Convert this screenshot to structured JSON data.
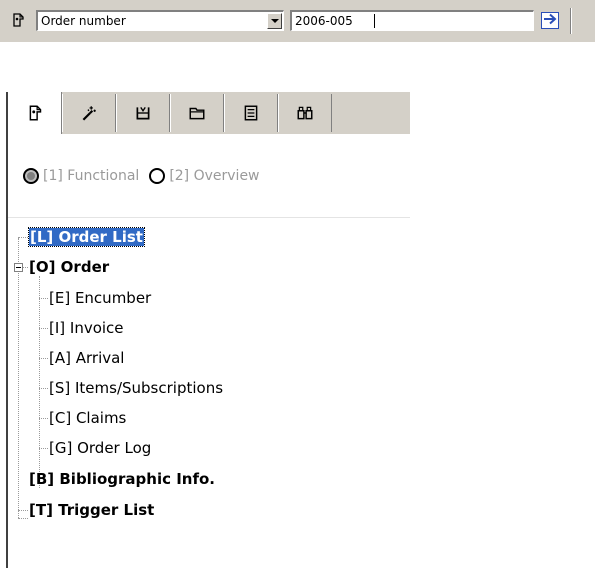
{
  "toolbar": {
    "search_field_label": "Order number",
    "search_value": "2006-005",
    "icons": {
      "leading": "order-tag-icon",
      "go": "arrow-right-icon",
      "dropdown": "chevron-down-icon"
    }
  },
  "panel": {
    "tabs": [
      {
        "icon": "order-tag-icon",
        "active": true
      },
      {
        "icon": "wand-icon",
        "active": false
      },
      {
        "icon": "box-icon",
        "active": false
      },
      {
        "icon": "folder-icon",
        "active": false
      },
      {
        "icon": "list-icon",
        "active": false
      },
      {
        "icon": "binoculars-icon",
        "active": false
      }
    ],
    "view_options": [
      {
        "label": "[1] Functional",
        "selected": true
      },
      {
        "label": "[2] Overview",
        "selected": false
      }
    ],
    "tree": [
      {
        "label": "[L] Order List",
        "bold": true,
        "selected": true,
        "level": 0
      },
      {
        "label": "[O] Order",
        "bold": true,
        "selected": false,
        "level": 0,
        "expanded": true
      },
      {
        "label": "[E] Encumber",
        "bold": false,
        "level": 1
      },
      {
        "label": "[I] Invoice",
        "bold": false,
        "level": 1
      },
      {
        "label": "[A] Arrival",
        "bold": false,
        "level": 1
      },
      {
        "label": "[S] Items/Subscriptions",
        "bold": false,
        "level": 1
      },
      {
        "label": "[C] Claims",
        "bold": false,
        "level": 1
      },
      {
        "label": "[G] Order Log",
        "bold": false,
        "level": 1
      },
      {
        "label": "[B] Bibliographic Info.",
        "bold": true,
        "level": 0
      },
      {
        "label": "[T] Trigger List",
        "bold": true,
        "level": 0
      }
    ]
  },
  "colors": {
    "chrome": "#d4d0c8",
    "selection": "#316ac5",
    "go_arrow": "#2b4fb8",
    "disabled_text": "#9a9a9a"
  }
}
